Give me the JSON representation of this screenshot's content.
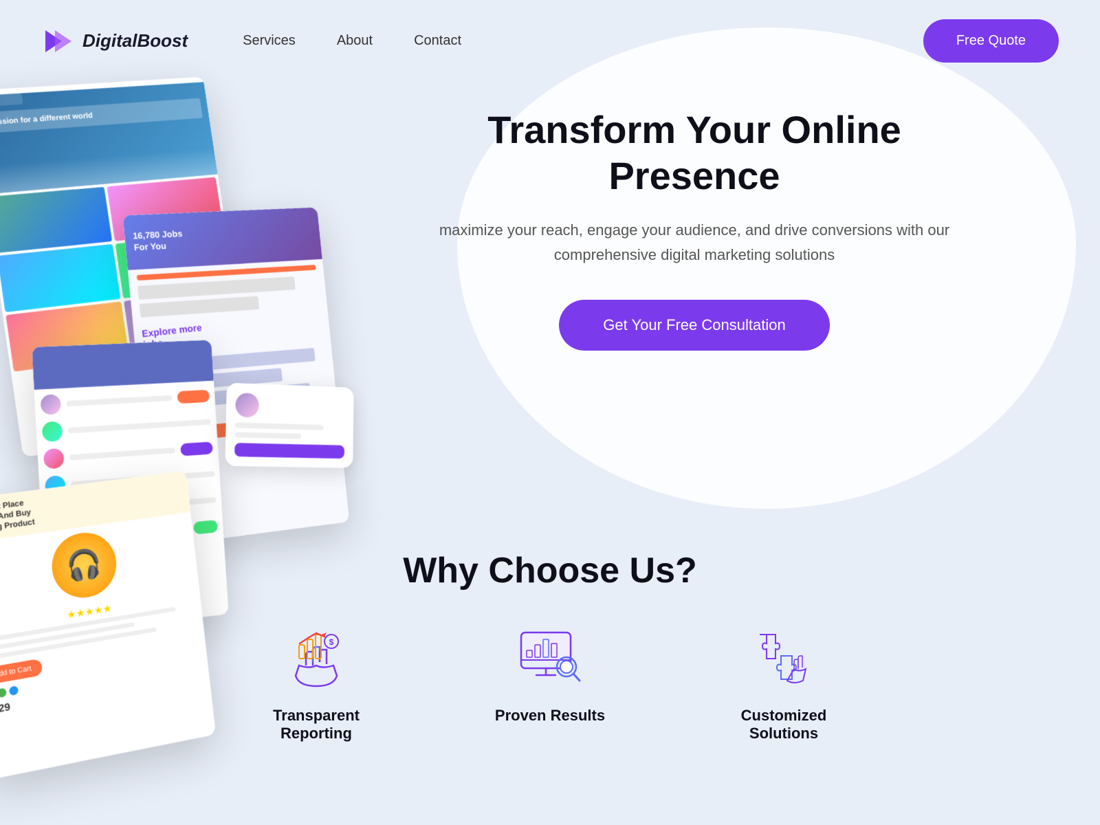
{
  "brand": {
    "name": "DigitalBoost",
    "logo_color": "#7c3aed"
  },
  "nav": {
    "links": [
      "Services",
      "About",
      "Contact"
    ],
    "cta_label": "Free Quote"
  },
  "hero": {
    "title": "Transform Your Online Presence",
    "subtitle": "maximize your reach, engage your audience, and drive conversions with our comprehensive digital marketing solutions",
    "cta_label": "Get Your Free Consultation"
  },
  "why_section": {
    "title": "Why Choose Us?",
    "features": [
      {
        "label": "Transparent Reporting",
        "icon": "chart-hand-icon"
      },
      {
        "label": "Proven Results",
        "icon": "analytics-search-icon"
      },
      {
        "label": "Customized Solutions",
        "icon": "puzzle-hand-icon"
      }
    ]
  }
}
